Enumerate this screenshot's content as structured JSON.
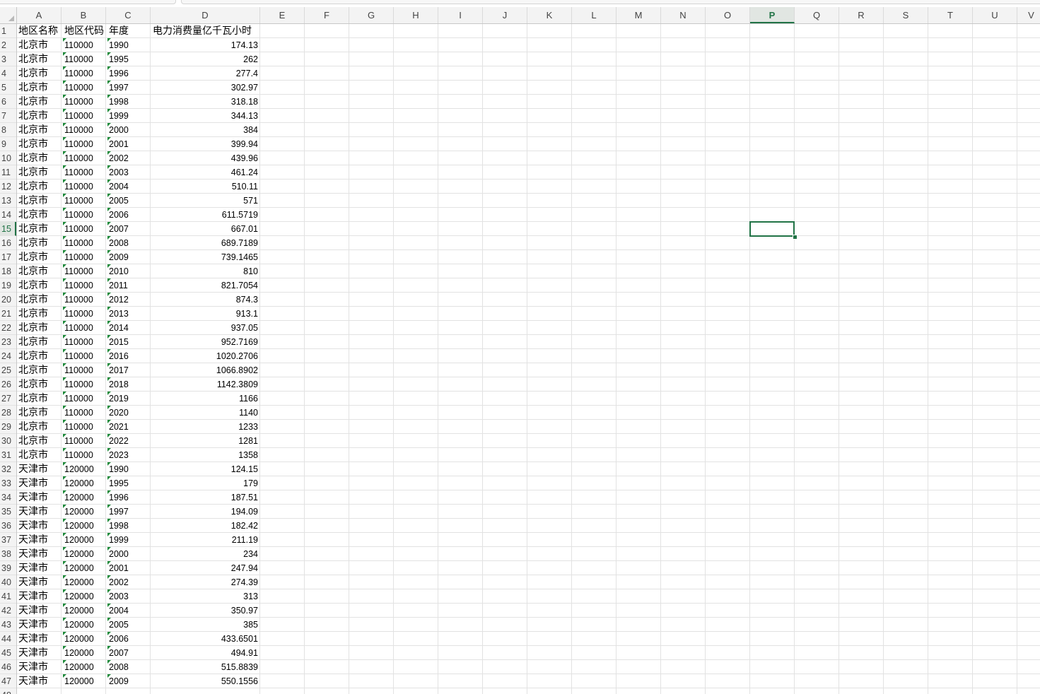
{
  "columns": [
    "A",
    "B",
    "C",
    "D",
    "E",
    "F",
    "G",
    "H",
    "I",
    "J",
    "K",
    "L",
    "M",
    "N",
    "O",
    "P",
    "Q",
    "R",
    "S",
    "T",
    "U",
    "V"
  ],
  "selected_column": "P",
  "selected_row": "15",
  "header": {
    "a": "地区名称",
    "b": "地区代码",
    "c": "年度",
    "d": "电力消费量亿千瓦小时"
  },
  "rows": [
    {
      "n": "2",
      "a": "北京市",
      "b": "110000",
      "c": "1990",
      "d": "174.13"
    },
    {
      "n": "3",
      "a": "北京市",
      "b": "110000",
      "c": "1995",
      "d": "262"
    },
    {
      "n": "4",
      "a": "北京市",
      "b": "110000",
      "c": "1996",
      "d": "277.4"
    },
    {
      "n": "5",
      "a": "北京市",
      "b": "110000",
      "c": "1997",
      "d": "302.97"
    },
    {
      "n": "6",
      "a": "北京市",
      "b": "110000",
      "c": "1998",
      "d": "318.18"
    },
    {
      "n": "7",
      "a": "北京市",
      "b": "110000",
      "c": "1999",
      "d": "344.13"
    },
    {
      "n": "8",
      "a": "北京市",
      "b": "110000",
      "c": "2000",
      "d": "384"
    },
    {
      "n": "9",
      "a": "北京市",
      "b": "110000",
      "c": "2001",
      "d": "399.94"
    },
    {
      "n": "10",
      "a": "北京市",
      "b": "110000",
      "c": "2002",
      "d": "439.96"
    },
    {
      "n": "11",
      "a": "北京市",
      "b": "110000",
      "c": "2003",
      "d": "461.24"
    },
    {
      "n": "12",
      "a": "北京市",
      "b": "110000",
      "c": "2004",
      "d": "510.11"
    },
    {
      "n": "13",
      "a": "北京市",
      "b": "110000",
      "c": "2005",
      "d": "571"
    },
    {
      "n": "14",
      "a": "北京市",
      "b": "110000",
      "c": "2006",
      "d": "611.5719"
    },
    {
      "n": "15",
      "a": "北京市",
      "b": "110000",
      "c": "2007",
      "d": "667.01"
    },
    {
      "n": "16",
      "a": "北京市",
      "b": "110000",
      "c": "2008",
      "d": "689.7189"
    },
    {
      "n": "17",
      "a": "北京市",
      "b": "110000",
      "c": "2009",
      "d": "739.1465"
    },
    {
      "n": "18",
      "a": "北京市",
      "b": "110000",
      "c": "2010",
      "d": "810"
    },
    {
      "n": "19",
      "a": "北京市",
      "b": "110000",
      "c": "2011",
      "d": "821.7054"
    },
    {
      "n": "20",
      "a": "北京市",
      "b": "110000",
      "c": "2012",
      "d": "874.3"
    },
    {
      "n": "21",
      "a": "北京市",
      "b": "110000",
      "c": "2013",
      "d": "913.1"
    },
    {
      "n": "22",
      "a": "北京市",
      "b": "110000",
      "c": "2014",
      "d": "937.05"
    },
    {
      "n": "23",
      "a": "北京市",
      "b": "110000",
      "c": "2015",
      "d": "952.7169"
    },
    {
      "n": "24",
      "a": "北京市",
      "b": "110000",
      "c": "2016",
      "d": "1020.2706"
    },
    {
      "n": "25",
      "a": "北京市",
      "b": "110000",
      "c": "2017",
      "d": "1066.8902"
    },
    {
      "n": "26",
      "a": "北京市",
      "b": "110000",
      "c": "2018",
      "d": "1142.3809"
    },
    {
      "n": "27",
      "a": "北京市",
      "b": "110000",
      "c": "2019",
      "d": "1166"
    },
    {
      "n": "28",
      "a": "北京市",
      "b": "110000",
      "c": "2020",
      "d": "1140"
    },
    {
      "n": "29",
      "a": "北京市",
      "b": "110000",
      "c": "2021",
      "d": "1233"
    },
    {
      "n": "30",
      "a": "北京市",
      "b": "110000",
      "c": "2022",
      "d": "1281"
    },
    {
      "n": "31",
      "a": "北京市",
      "b": "110000",
      "c": "2023",
      "d": "1358"
    },
    {
      "n": "32",
      "a": "天津市",
      "b": "120000",
      "c": "1990",
      "d": "124.15"
    },
    {
      "n": "33",
      "a": "天津市",
      "b": "120000",
      "c": "1995",
      "d": "179"
    },
    {
      "n": "34",
      "a": "天津市",
      "b": "120000",
      "c": "1996",
      "d": "187.51"
    },
    {
      "n": "35",
      "a": "天津市",
      "b": "120000",
      "c": "1997",
      "d": "194.09"
    },
    {
      "n": "36",
      "a": "天津市",
      "b": "120000",
      "c": "1998",
      "d": "182.42"
    },
    {
      "n": "37",
      "a": "天津市",
      "b": "120000",
      "c": "1999",
      "d": "211.19"
    },
    {
      "n": "38",
      "a": "天津市",
      "b": "120000",
      "c": "2000",
      "d": "234"
    },
    {
      "n": "39",
      "a": "天津市",
      "b": "120000",
      "c": "2001",
      "d": "247.94"
    },
    {
      "n": "40",
      "a": "天津市",
      "b": "120000",
      "c": "2002",
      "d": "274.39"
    },
    {
      "n": "41",
      "a": "天津市",
      "b": "120000",
      "c": "2003",
      "d": "313"
    },
    {
      "n": "42",
      "a": "天津市",
      "b": "120000",
      "c": "2004",
      "d": "350.97"
    },
    {
      "n": "43",
      "a": "天津市",
      "b": "120000",
      "c": "2005",
      "d": "385"
    },
    {
      "n": "44",
      "a": "天津市",
      "b": "120000",
      "c": "2006",
      "d": "433.6501"
    },
    {
      "n": "45",
      "a": "天津市",
      "b": "120000",
      "c": "2007",
      "d": "494.91"
    },
    {
      "n": "46",
      "a": "天津市",
      "b": "120000",
      "c": "2008",
      "d": "515.8839"
    },
    {
      "n": "47",
      "a": "天津市",
      "b": "120000",
      "c": "2009",
      "d": "550.1556"
    }
  ],
  "colors": {
    "accent": "#217346",
    "number_as_text_marker": "#1e8a3a",
    "gridline": "#e2e2e2",
    "header_bg": "#f3f3f3"
  },
  "icons": {
    "corner": "select-all-triangle-icon",
    "number_as_text": "text-number-indicator-icon"
  }
}
